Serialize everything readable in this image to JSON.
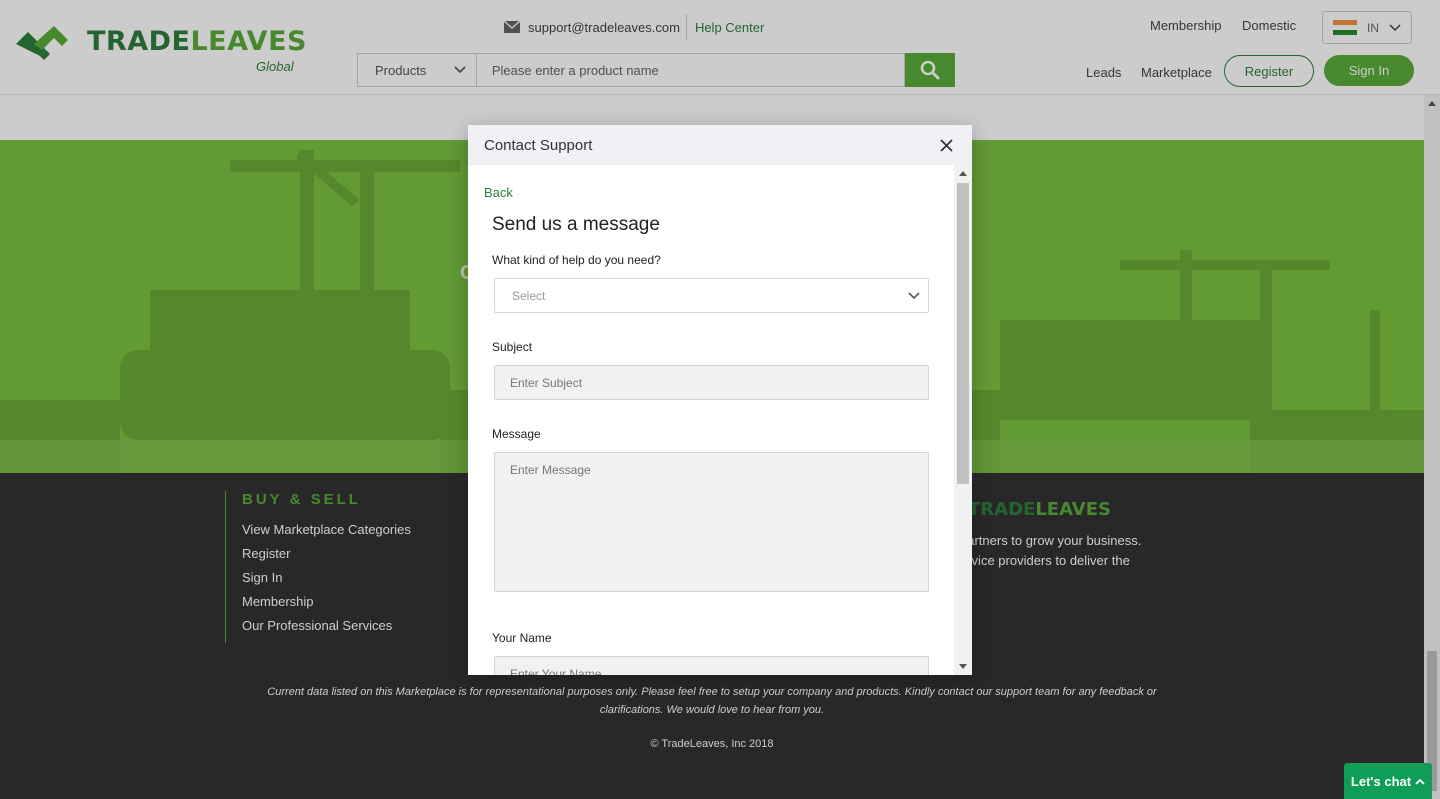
{
  "brand": {
    "name_part1": "TRADE",
    "name_part2": "LEAVES",
    "tagline": "Global",
    "colors": {
      "dark_green": "#2e7d3c",
      "light_green": "#5aaa3a"
    }
  },
  "header": {
    "support_email": "support@tradeleaves.com",
    "help_center": "Help Center",
    "membership": "Membership",
    "domestic": "Domestic",
    "country_code": "IN",
    "search": {
      "category": "Products",
      "placeholder": "Please enter a product name"
    },
    "leads": "Leads",
    "marketplace": "Marketplace",
    "register": "Register",
    "sign_in": "Sign In"
  },
  "footer": {
    "heading": "BUY & SELL",
    "links": [
      "View Marketplace Categories",
      "Register",
      "Sign In",
      "Membership",
      "Our Professional Services"
    ],
    "about_line1": "partners to grow your business.",
    "about_line2": "ervice providers to deliver the",
    "disclaimer": "Current data listed on this Marketplace is for representational purposes only. Please feel free to setup your company and products. Kindly contact our support team for any feedback or clarifications. We would love to hear from you.",
    "copyright": "© TradeLeaves, Inc 2018"
  },
  "modal": {
    "title": "Contact Support",
    "back": "Back",
    "form_title": "Send us a message",
    "help_label": "What kind of help do you need?",
    "help_select": "Select",
    "subject_label": "Subject",
    "subject_placeholder": "Enter Subject",
    "message_label": "Message",
    "message_placeholder": "Enter Message",
    "name_label": "Your Name",
    "name_placeholder": "Enter Your Name"
  },
  "chat": {
    "label": "Let's chat"
  },
  "icons": {
    "mail": "mail-icon",
    "search": "search-icon",
    "close": "close-icon",
    "chevron": "chevron-down-icon",
    "flag": "india-flag-icon"
  }
}
